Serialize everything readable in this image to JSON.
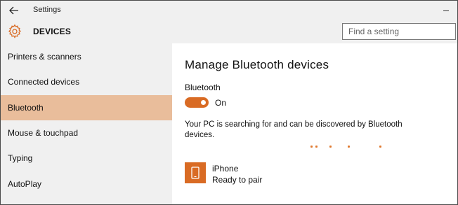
{
  "titlebar": {
    "title": "Settings",
    "back_icon": "arrow-left-icon",
    "minimize_icon": "minimize-icon"
  },
  "header": {
    "icon": "gear-icon",
    "title": "DEVICES",
    "search_placeholder": "Find a setting"
  },
  "sidebar": {
    "items": [
      {
        "label": "Printers & scanners",
        "active": false
      },
      {
        "label": "Connected devices",
        "active": false
      },
      {
        "label": "Bluetooth",
        "active": true
      },
      {
        "label": "Mouse & touchpad",
        "active": false
      },
      {
        "label": "Typing",
        "active": false
      },
      {
        "label": "AutoPlay",
        "active": false
      }
    ]
  },
  "content": {
    "title": "Manage Bluetooth devices",
    "bluetooth_label": "Bluetooth",
    "toggle_state": "On",
    "toggle_on": true,
    "status_line": "Your PC is searching for and can be discovered by Bluetooth devices.",
    "devices": [
      {
        "name": "iPhone",
        "status": "Ready to pair",
        "icon": "phone-icon"
      }
    ]
  },
  "colors": {
    "accent": "#d96b24",
    "selected_nav": "#e9bd9b",
    "chrome_bg": "#f0f0f0"
  }
}
